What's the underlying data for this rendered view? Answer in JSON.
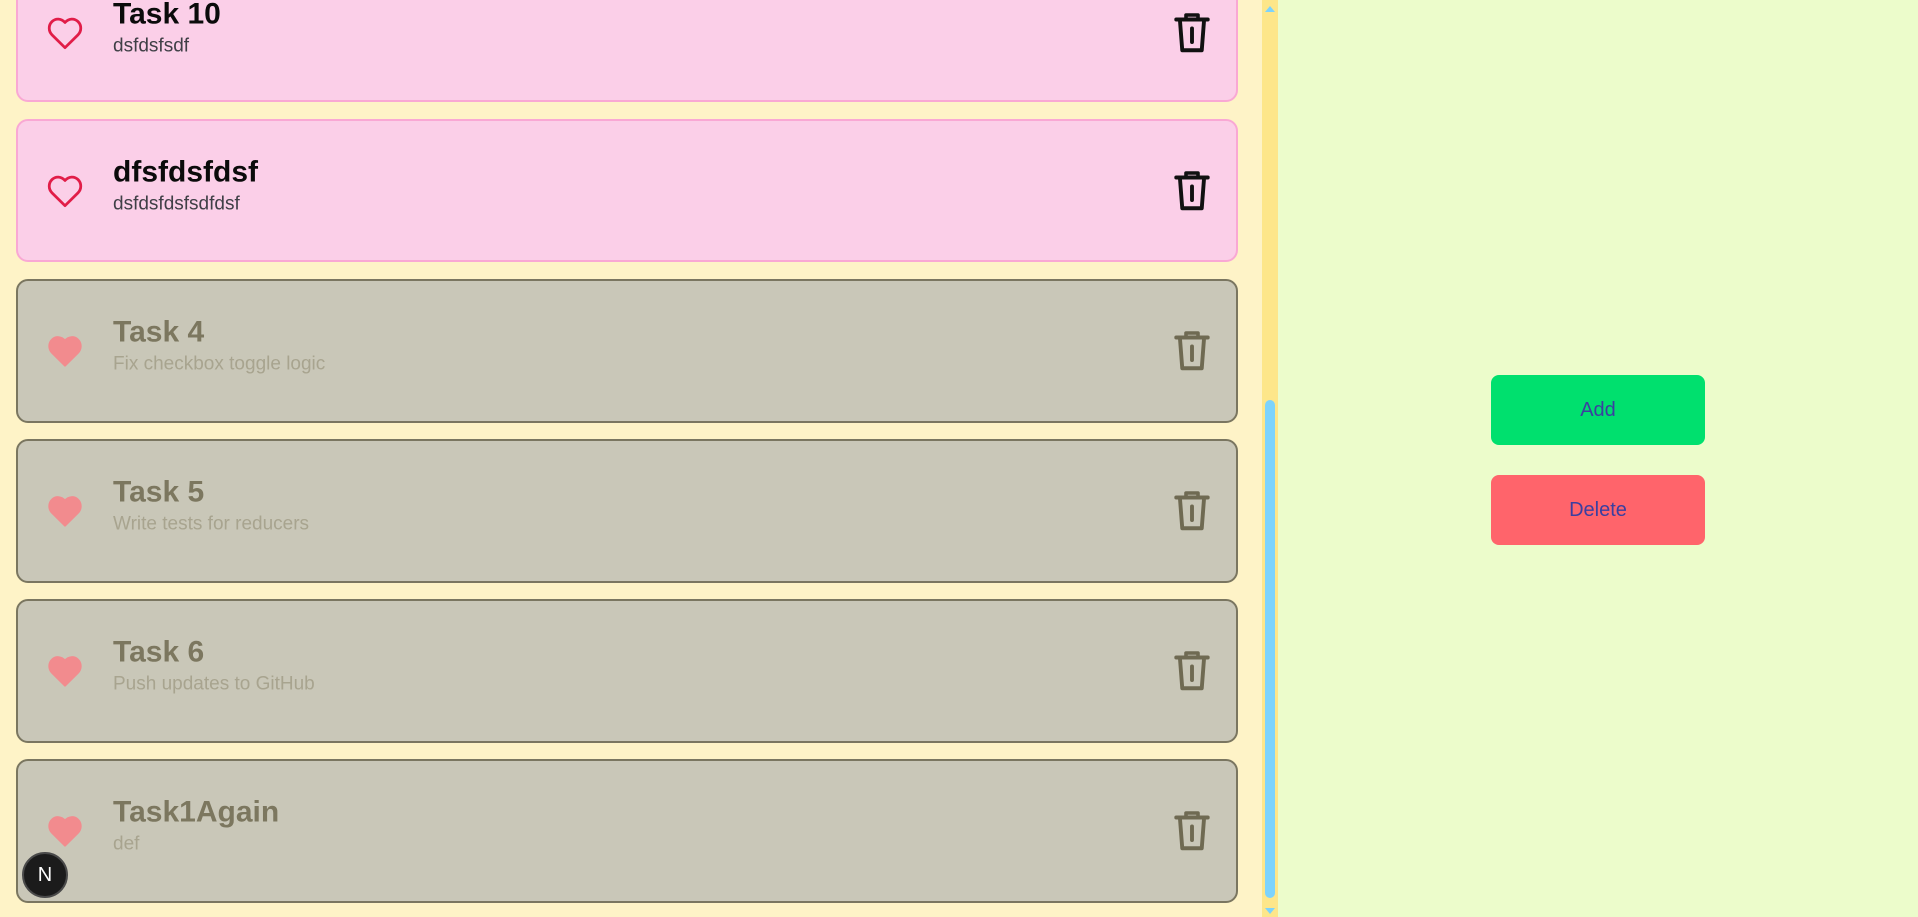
{
  "tasks": [
    {
      "title": "Task 10",
      "description": "dsfdsfsdf",
      "state": "active",
      "liked": false
    },
    {
      "title": "dfsfdsfdsf",
      "description": "dsfdsfdsfsdfdsf",
      "state": "active",
      "liked": false
    },
    {
      "title": "Task 4",
      "description": "Fix checkbox toggle logic",
      "state": "done",
      "liked": true
    },
    {
      "title": "Task 5",
      "description": "Write tests for reducers",
      "state": "done",
      "liked": true
    },
    {
      "title": "Task 6",
      "description": "Push updates to GitHub",
      "state": "done",
      "liked": true
    },
    {
      "title": "Task1Again",
      "description": "def",
      "state": "done",
      "liked": true
    }
  ],
  "actions": {
    "add_label": "Add",
    "delete_label": "Delete"
  },
  "dev_badge": {
    "label": "N"
  },
  "icons": {
    "like": "heart-icon",
    "remove": "trash-icon"
  },
  "colors": {
    "active_card_bg": "#fbcfe8",
    "done_card_bg": "#c9c7b8",
    "add_button": "#00e06e",
    "delete_button": "#ff646b",
    "heart_outline": "#e11d48",
    "heart_filled": "#f28b8e"
  }
}
